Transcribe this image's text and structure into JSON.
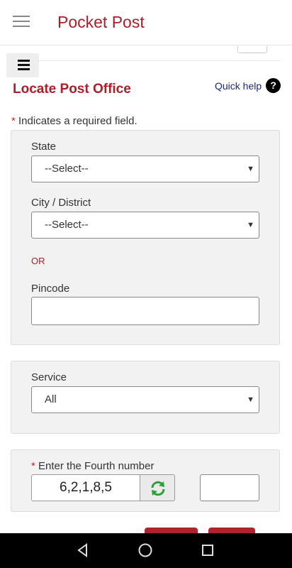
{
  "appbar": {
    "title": "Pocket Post",
    "menu_icon": "hamburger-menu-icon"
  },
  "page": {
    "heading": "Locate Post Office",
    "quick_help": "Quick help",
    "quick_help_icon": "?",
    "required_star": "*",
    "required_note": "Indicates a required field."
  },
  "location": {
    "state_label": "State",
    "state_value": "--Select--",
    "city_label": "City / District",
    "city_value": "--Select--",
    "or_text": "OR",
    "pincode_label": "Pincode",
    "pincode_value": ""
  },
  "service": {
    "label": "Service",
    "value": "All"
  },
  "captcha": {
    "star": "*",
    "label": "Enter the Fourth number",
    "code": "6,2,1,8,5",
    "answer": ""
  },
  "colors": {
    "brand_red": "#a8202a",
    "link_blue": "#1e2a78",
    "refresh_green": "#2e9e3a"
  }
}
